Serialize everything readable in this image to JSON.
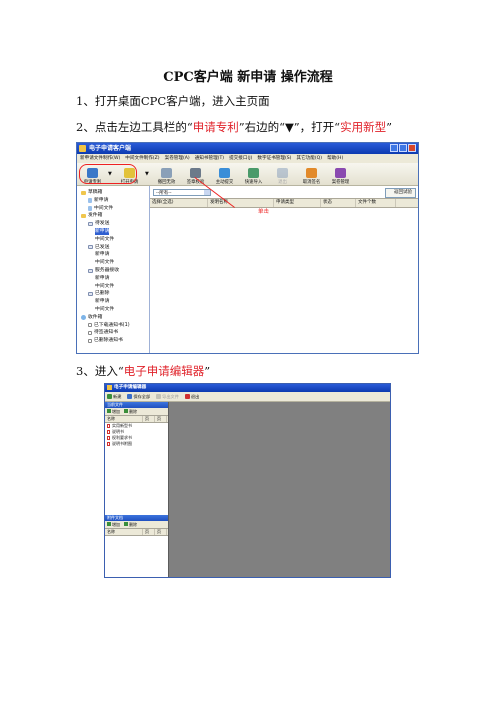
{
  "doc": {
    "title": "CPC客户端  新申请  操作流程",
    "step1": "1、打开桌面CPC客户端，进入主页面",
    "step2_pre": "2、点击左边工具栏的“",
    "step2_hl1": "申请专利",
    "step2_mid": "”右边的“▼”，打开“",
    "step2_hl2": "实用新型",
    "step2_post": "”",
    "step3_pre": "3、进入“",
    "step3_hl": "电子申请编辑器",
    "step3_post": "”",
    "accent_red": "#e0232b"
  },
  "client_window": {
    "title": "电子申请客户端",
    "menu": [
      "新申请文件制作(W)",
      "中间文件制作(Z)",
      "案卷管理(A)",
      "通知书管理(T)",
      "提交接口(J)",
      "数字证书管理(S)",
      "其它功能(Q)",
      "帮助(H)"
    ],
    "toolbar": [
      {
        "label": "申请专利",
        "icon": "people-icon",
        "color": "#3a78c8",
        "disabled": false
      },
      {
        "label": "打开申请",
        "icon": "open-icon",
        "color": "#e2c23a",
        "disabled": false
      },
      {
        "label": "撤回无效",
        "icon": "undo-icon",
        "color": "#8aa0b8",
        "disabled": false
      },
      {
        "label": "签章校验",
        "icon": "sign-icon",
        "color": "#6c7a8a",
        "disabled": false
      },
      {
        "label": "主动提交",
        "icon": "submit-icon",
        "color": "#3a8ed8",
        "disabled": false
      },
      {
        "label": "快速导入",
        "icon": "import-icon",
        "color": "#4a9a6a",
        "disabled": false
      },
      {
        "label": "退出",
        "icon": "exit-icon",
        "color": "#5577aa",
        "disabled": true
      },
      {
        "label": "取消签名",
        "icon": "cancel-sign-icon",
        "color": "#e28a2a",
        "disabled": false
      },
      {
        "label": "案卷管理",
        "icon": "books-icon",
        "color": "#8a4ab0",
        "disabled": false
      }
    ],
    "tree": [
      {
        "label": "草稿箱",
        "level": 0,
        "icon": "fold"
      },
      {
        "label": "新申请",
        "level": 1,
        "icon": "doc"
      },
      {
        "label": "中间文件",
        "level": 1,
        "icon": "doc"
      },
      {
        "label": "发件箱",
        "level": 0,
        "icon": "fold"
      },
      {
        "label": "待发送",
        "level": 1,
        "icon": "env"
      },
      {
        "label": "新申请",
        "level": 2,
        "icon": "none",
        "selected": true
      },
      {
        "label": "中间文件",
        "level": 2,
        "icon": "none"
      },
      {
        "label": "已发送",
        "level": 1,
        "icon": "env"
      },
      {
        "label": "新申请",
        "level": 2,
        "icon": "none"
      },
      {
        "label": "中间文件",
        "level": 2,
        "icon": "none"
      },
      {
        "label": "服务器接收",
        "level": 1,
        "icon": "env"
      },
      {
        "label": "新申请",
        "level": 2,
        "icon": "none"
      },
      {
        "label": "中间文件",
        "level": 2,
        "icon": "none"
      },
      {
        "label": "已删除",
        "level": 1,
        "icon": "env"
      },
      {
        "label": "新申请",
        "level": 2,
        "icon": "none"
      },
      {
        "label": "中间文件",
        "level": 2,
        "icon": "none"
      },
      {
        "label": "收件箱",
        "level": 0,
        "icon": "globe"
      },
      {
        "label": "已下载通知书(1)",
        "level": 1,
        "icon": "box"
      },
      {
        "label": "待签通知书",
        "level": 1,
        "icon": "box"
      },
      {
        "label": "已删除通知书",
        "level": 1,
        "icon": "box"
      }
    ],
    "filter_value": "--所有--",
    "back_button": "返回试验",
    "columns": [
      "选择(全选)",
      "发明名称",
      "申请类型",
      "状态",
      "文件个数"
    ],
    "callout": "单击"
  },
  "editor_window": {
    "title": "电子申请编辑器",
    "toolbar": [
      {
        "label": "新建",
        "color": "#3a8e3a",
        "disabled": false
      },
      {
        "label": "保存全部",
        "color": "#3a6ec8",
        "disabled": false
      },
      {
        "label": "导出文件",
        "color": "#888888",
        "disabled": true
      },
      {
        "label": "退出",
        "color": "#d03030",
        "disabled": false
      }
    ],
    "panel1": {
      "title": "当前文件",
      "tools": [
        "增加",
        "删除"
      ],
      "headers": [
        "名称",
        "页",
        "页"
      ],
      "items": [
        "实用新型书",
        "说明书",
        "权利要求书",
        "说明书附图"
      ]
    },
    "panel2": {
      "title": "附件文档",
      "tools": [
        "增加",
        "删除"
      ],
      "headers": [
        "名称",
        "页",
        "页"
      ]
    }
  }
}
